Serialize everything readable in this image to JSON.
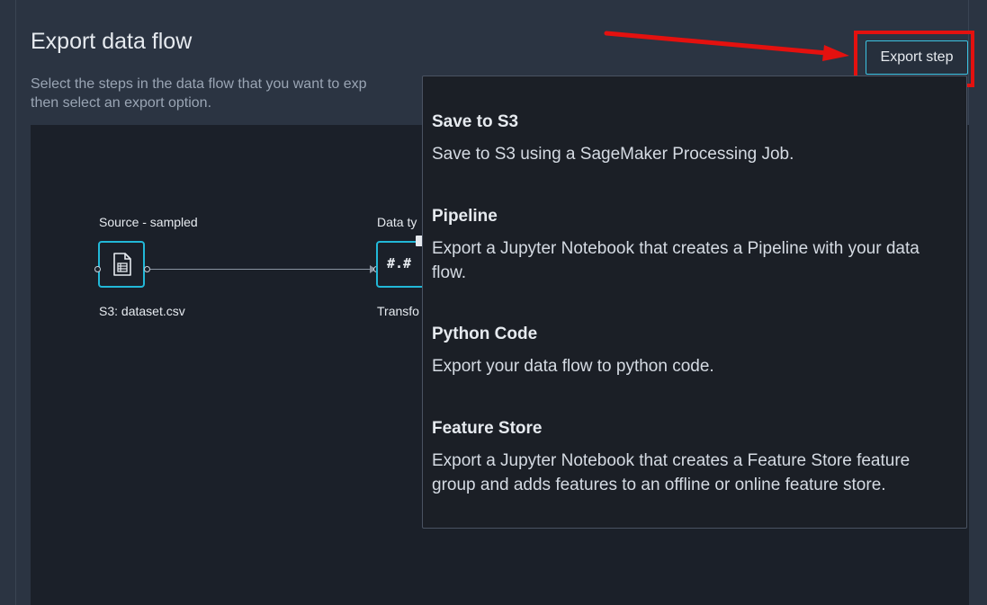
{
  "title": "Export data flow",
  "description": "Select the steps in the data flow that you want to exp\nthen select an export option.",
  "export_button": "Export step",
  "flow": {
    "source": {
      "title": "Source - sampled",
      "label": "S3: dataset.csv"
    },
    "transform": {
      "title": "Data ty",
      "label": "Transfo",
      "icon_text": "#.#"
    }
  },
  "menu": {
    "items": [
      {
        "title": "Save to S3",
        "desc": "Save to S3 using a SageMaker Processing Job."
      },
      {
        "title": "Pipeline",
        "desc": "Export a Jupyter Notebook that creates a Pipeline with your data flow."
      },
      {
        "title": "Python Code",
        "desc": "Export your data flow to python code."
      },
      {
        "title": "Feature Store",
        "desc": "Export a Jupyter Notebook that creates a Feature Store feature group and adds features to an offline or online feature store."
      }
    ]
  },
  "colors": {
    "accent": "#22b8d8",
    "annotation": "#e4110f"
  },
  "icons": {
    "source": "document-table-icon",
    "arrow": "red-arrow-icon"
  }
}
